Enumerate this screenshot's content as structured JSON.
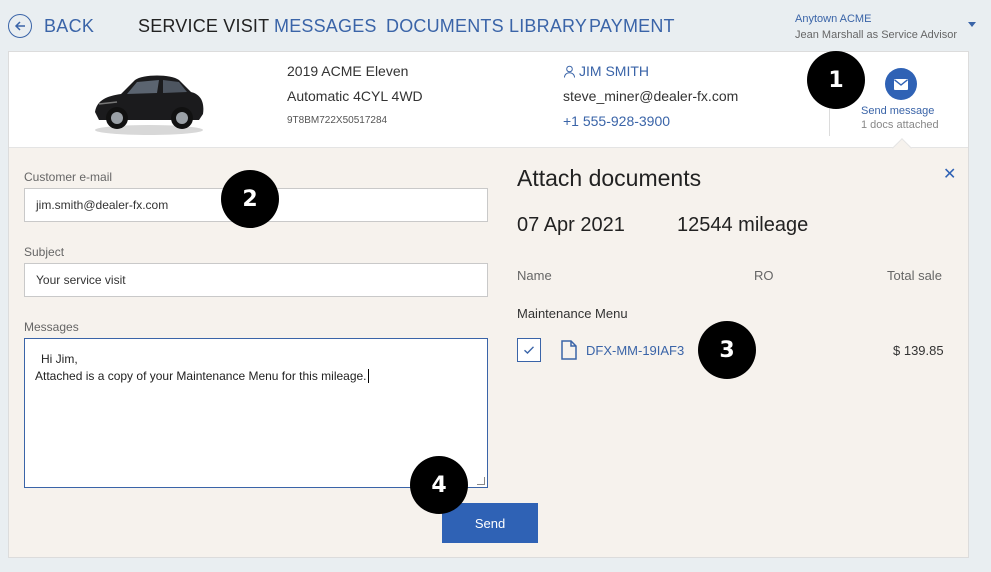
{
  "nav": {
    "back_label": "BACK",
    "tabs": [
      {
        "label": "SERVICE VISIT",
        "active": true
      },
      {
        "label": "MESSAGES",
        "active": false
      },
      {
        "label": "DOCUMENTS LIBRARY",
        "active": false
      },
      {
        "label": "PAYMENT",
        "active": false
      }
    ],
    "account": {
      "dealer": "Anytown ACME",
      "user": "Jean Marshall as Service Advisor"
    }
  },
  "vehicle": {
    "model": "2019 ACME Eleven",
    "spec": "Automatic 4CYL 4WD",
    "vin": "9T8BM722X50517284"
  },
  "customer": {
    "name": "JIM SMITH",
    "email": "steve_miner@dealer-fx.com",
    "phone": "+1 555-928-3900"
  },
  "send_message": {
    "label": "Send message",
    "docs_attached": "1 docs attached"
  },
  "form": {
    "email_label": "Customer e-mail",
    "email_value": "jim.smith@dealer-fx.com",
    "subject_label": "Subject",
    "subject_value": "Your service visit",
    "messages_label": "Messages",
    "message_line1": "Hi Jim,",
    "message_line2": "Attached is a copy of your Maintenance Menu for this mileage.",
    "send_label": "Send"
  },
  "attach": {
    "title": "Attach documents",
    "date": "07 Apr 2021",
    "mileage": "12544 mileage",
    "columns": {
      "name": "Name",
      "ro": "RO",
      "total": "Total sale"
    },
    "section": "Maintenance Menu",
    "document": {
      "name": "DFX-MM-19IAF3",
      "total": "$ 139.85",
      "checked": true
    }
  },
  "markers": [
    "1",
    "2",
    "3",
    "4"
  ],
  "colors": {
    "accent": "#2f62b5",
    "link": "#3a64a8",
    "panel": "#f6f2ed"
  }
}
